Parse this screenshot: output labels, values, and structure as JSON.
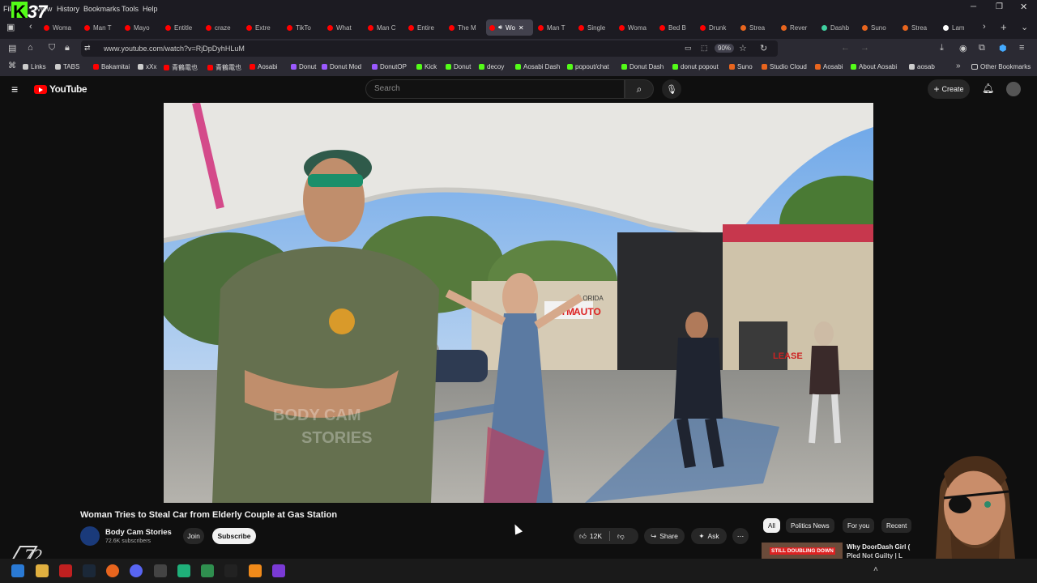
{
  "browser": {
    "menu": [
      "File",
      "View",
      "History",
      "Bookmarks",
      "Tools",
      "Help"
    ],
    "overlay_number": "37",
    "tabs": [
      {
        "label": "Woma",
        "color": "#ff0000"
      },
      {
        "label": "Man T",
        "color": "#ff0000"
      },
      {
        "label": "Mayo",
        "color": "#ff0000"
      },
      {
        "label": "Entitle",
        "color": "#ff0000"
      },
      {
        "label": "craze",
        "color": "#ff0000"
      },
      {
        "label": "Extre",
        "color": "#ff0000"
      },
      {
        "label": "TikTo",
        "color": "#ff0000"
      },
      {
        "label": "What",
        "color": "#ff0000"
      },
      {
        "label": "Man C",
        "color": "#ff0000"
      },
      {
        "label": "Entire",
        "color": "#ff0000"
      },
      {
        "label": "The M",
        "color": "#ff0000"
      },
      {
        "label": "Wo",
        "color": "#ff0000",
        "active": true
      },
      {
        "label": "Man T",
        "color": "#ff0000"
      },
      {
        "label": "Single",
        "color": "#ff0000"
      },
      {
        "label": "Woma",
        "color": "#ff0000"
      },
      {
        "label": "Bed B",
        "color": "#ff0000"
      },
      {
        "label": "Drunk",
        "color": "#ff0000"
      },
      {
        "label": "Strea",
        "color": "#e8651e"
      },
      {
        "label": "Rever",
        "color": "#e8651e"
      },
      {
        "label": "Dashb",
        "color": "#3fd0a0"
      },
      {
        "label": "Suno",
        "color": "#e8651e"
      },
      {
        "label": "Strea",
        "color": "#e8651e"
      },
      {
        "label": "Lam",
        "color": "#ffffff"
      }
    ],
    "url": "www.youtube.com/watch?v=RjDpDyhHLuM",
    "zoom": "90%",
    "bookmarks": [
      {
        "label": "Links",
        "color": "#ccc"
      },
      {
        "label": "TABS",
        "color": "#ccc"
      },
      {
        "label": "Bakamitai",
        "color": "#ff0000"
      },
      {
        "label": "xXx",
        "color": "#ccc"
      },
      {
        "label": "青鶴電也",
        "color": "#ff0000"
      },
      {
        "label": "青鶴電也",
        "color": "#ff0000"
      },
      {
        "label": "Aosabi",
        "color": "#ff0000"
      },
      {
        "label": "Donut",
        "color": "#9b59ff"
      },
      {
        "label": "Donut Mod",
        "color": "#9b59ff"
      },
      {
        "label": "DonutOP",
        "color": "#9b59ff"
      },
      {
        "label": "Kick",
        "color": "#53fc18"
      },
      {
        "label": "Donut",
        "color": "#53fc18"
      },
      {
        "label": "decoy",
        "color": "#53fc18"
      },
      {
        "label": "Aosabi Dash",
        "color": "#53fc18"
      },
      {
        "label": "popout/chat",
        "color": "#53fc18"
      },
      {
        "label": "Donut Dash",
        "color": "#53fc18"
      },
      {
        "label": "donut popout",
        "color": "#53fc18"
      },
      {
        "label": "Suno",
        "color": "#e8651e"
      },
      {
        "label": "Studio Cloud",
        "color": "#e8651e"
      },
      {
        "label": "Aosabi",
        "color": "#e8651e"
      },
      {
        "label": "About Aosabi",
        "color": "#53fc18"
      },
      {
        "label": "aosab",
        "color": "#ccc"
      }
    ],
    "other_bookmarks": "Other Bookmarks"
  },
  "youtube": {
    "logo": "YouTube",
    "search_placeholder": "Search",
    "create_label": "Create",
    "video": {
      "watermark_line1": "BODY CAM",
      "watermark_line2": "STORIES",
      "sign_atm": "ATM",
      "sign_auto": "AUTO",
      "sign_florida": "FLORIDA",
      "sign_lease": "LEASE"
    },
    "title": "Woman Tries to Steal Car from Elderly Couple at Gas Station",
    "channel": {
      "name": "Body Cam Stories",
      "subscribers": "72.6K subscribers",
      "join_label": "Join",
      "subscribe_label": "Subscribe"
    },
    "actions": {
      "likes": "12K",
      "share_label": "Share",
      "ask_label": "Ask"
    },
    "chips": [
      "All",
      "Politics News",
      "For you",
      "Recent"
    ],
    "recommended": {
      "thumb_text": "STILL DOUBLING DOWN",
      "title_line1": "Why DoorDash Girl (",
      "title_line2": "Pled Not Guilty | L"
    }
  },
  "stream_overlay": {
    "logo_text": "72"
  }
}
